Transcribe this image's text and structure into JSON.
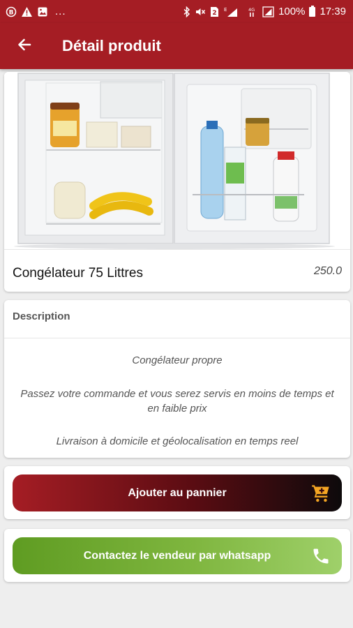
{
  "status_bar": {
    "left_icons": [
      "bixby-icon",
      "warning-icon",
      "gallery-icon"
    ],
    "overflow": "...",
    "battery_percent": "100%",
    "time": "17:39",
    "sim_badge": "2"
  },
  "app_bar": {
    "title": "Détail produit",
    "back_icon": "arrow-left-icon"
  },
  "product": {
    "image": "mini-fridge-photo",
    "name": "Congélateur 75 Littres",
    "price": "250.0"
  },
  "description": {
    "header": "Description",
    "lines": [
      "Congélateur propre",
      "Passez votre commande et vous serez servis en moins de temps et en faible prix",
      "Livraison à domicile et géolocalisation en temps reel"
    ]
  },
  "actions": {
    "cart_label": "Ajouter au pannier",
    "cart_icon": "cart-icon",
    "whatsapp_label": "Contactez le vendeur par whatsapp",
    "whatsapp_icon": "phone-icon"
  },
  "colors": {
    "primary": "#a51d24",
    "cart_gradient_end": "#0d0a0b",
    "whatsapp_green": "#7fb63f",
    "cart_icon": "#f5a623"
  }
}
